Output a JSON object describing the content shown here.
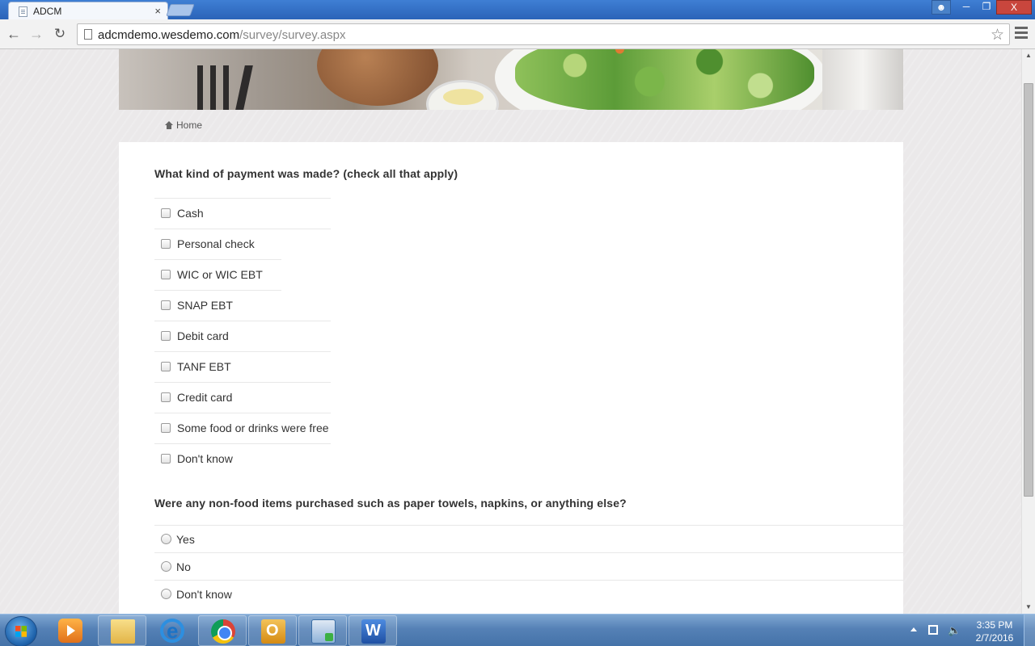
{
  "browser": {
    "tab_title": "ADCM",
    "tab_close": "×",
    "url_host": "adcmdemo.wesdemo.com",
    "url_path": "/survey/survey.aspx",
    "window_close": "X"
  },
  "page": {
    "breadcrumb_home": "Home"
  },
  "survey": {
    "q1": {
      "question": "What kind of payment was made? (check all that apply)",
      "options": [
        {
          "label": "Cash",
          "checked": false
        },
        {
          "label": "Personal check",
          "checked": false
        },
        {
          "label": "WIC or WIC EBT",
          "checked": false
        },
        {
          "label": "SNAP EBT",
          "checked": false
        },
        {
          "label": "Debit card",
          "checked": false
        },
        {
          "label": "TANF EBT",
          "checked": false
        },
        {
          "label": "Credit card",
          "checked": false
        },
        {
          "label": "Some food or drinks were free",
          "checked": false
        },
        {
          "label": "Don't know",
          "checked": false
        }
      ]
    },
    "q2": {
      "question": "Were any non-food items purchased such as paper towels, napkins, or anything else?",
      "options": [
        {
          "label": "Yes",
          "selected": false
        },
        {
          "label": "No",
          "selected": false
        },
        {
          "label": "Don't know",
          "selected": false
        }
      ]
    }
  },
  "taskbar": {
    "apps": [
      "windows-media-player",
      "windows-explorer",
      "internet-explorer",
      "google-chrome",
      "outlook",
      "remote-desktop",
      "microsoft-word"
    ],
    "clock_time": "3:35 PM",
    "clock_date": "2/7/2016"
  },
  "colors": {
    "accent": "#2a63b8",
    "page_bg": "#ebe9ea",
    "card_bg": "#ffffff",
    "text": "#333333"
  }
}
